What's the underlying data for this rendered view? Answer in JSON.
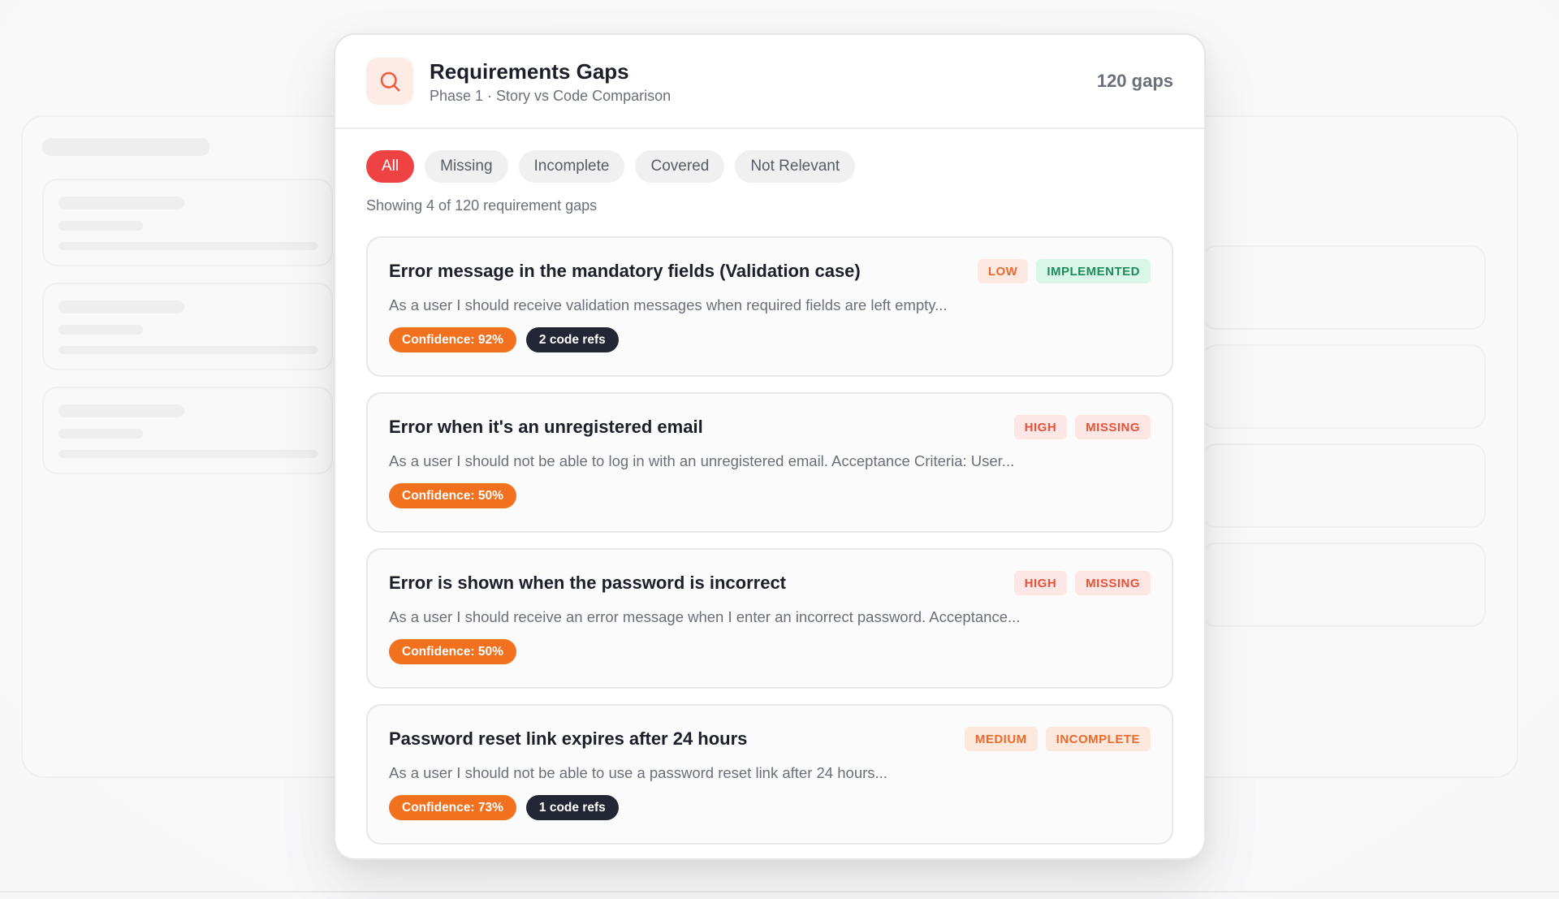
{
  "header": {
    "title": "Requirements Gaps",
    "subtitle": "Phase 1 · Story vs Code Comparison",
    "gap_count": "120 gaps"
  },
  "filters": {
    "all": "All",
    "missing": "Missing",
    "incomplete": "Incomplete",
    "covered": "Covered",
    "not_relevant": "Not Relevant",
    "active": "All"
  },
  "showing_text": "Showing 4 of 120 requirement gaps",
  "colors": {
    "accent": "#ef4343",
    "confidence": "#f2711f",
    "code_refs": "#232735",
    "low_bg": "#fde9e1",
    "low_fg": "#ea6a2c",
    "high_bg": "#fde7e4",
    "high_fg": "#e5533c",
    "medium_bg": "#fde8de",
    "medium_fg": "#ea6a2c",
    "implemented_bg": "#d9f6e8",
    "implemented_fg": "#1f8a5b",
    "missing_bg": "#fde7e4",
    "missing_fg": "#e5533c",
    "incomplete_bg": "#fde8de",
    "incomplete_fg": "#ea6a2c"
  },
  "gaps": [
    {
      "title": "Error message in the mandatory fields (Validation case)",
      "priority": "LOW",
      "status": "IMPLEMENTED",
      "description": "As a user I should receive validation messages when required fields are left empty...",
      "confidence": "Confidence: 92%",
      "code_refs": "2 code refs"
    },
    {
      "title": "Error when it's an unregistered email",
      "priority": "HIGH",
      "status": "MISSING",
      "description": "As a user I should not be able to log in with an unregistered email. Acceptance Criteria: User...",
      "confidence": "Confidence: 50%"
    },
    {
      "title": "Error is shown when the password is incorrect",
      "priority": "HIGH",
      "status": "MISSING",
      "description": "As a user I should receive an error message when I enter an incorrect password. Acceptance...",
      "confidence": "Confidence: 50%"
    },
    {
      "title": "Password reset link expires after 24 hours",
      "priority": "MEDIUM",
      "status": "INCOMPLETE",
      "description": "As a user I should not be able to use a password reset link after 24 hours...",
      "confidence": "Confidence: 73%",
      "code_refs": "1 code refs"
    }
  ]
}
